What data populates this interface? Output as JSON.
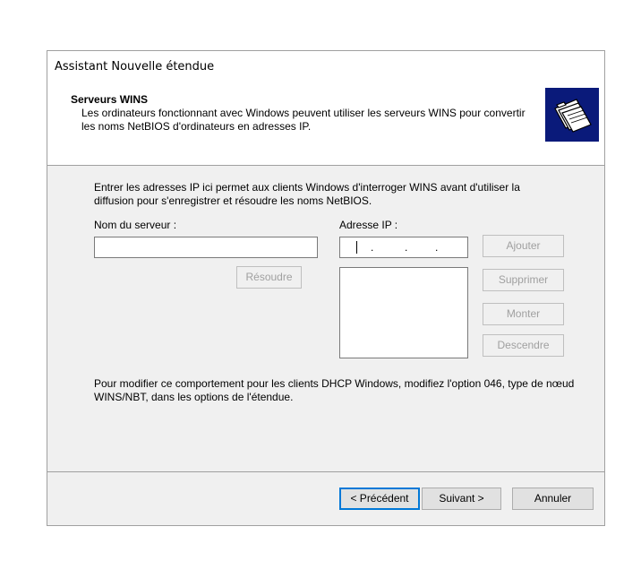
{
  "window": {
    "title": "Assistant Nouvelle étendue"
  },
  "header": {
    "title": "Serveurs WINS",
    "description": "Les ordinateurs fonctionnant avec Windows peuvent utiliser les serveurs WINS pour convertir les noms NetBIOS d'ordinateurs en adresses IP.",
    "icon": "wizard-folders-icon"
  },
  "body": {
    "instruction": "Entrer les adresses IP ici permet aux clients Windows d'interroger WINS avant d'utiliser la diffusion pour s'enregistrer et résoudre les noms NetBIOS.",
    "server_name_label": "Nom du serveur :",
    "server_name_value": "",
    "ip_label": "Adresse IP :",
    "ip_dots": [
      ".",
      ".",
      "."
    ],
    "resolve_label": "Résoudre",
    "add_label": "Ajouter",
    "remove_label": "Supprimer",
    "up_label": "Monter",
    "down_label": "Descendre",
    "note": "Pour modifier ce comportement pour les clients DHCP Windows, modifiez l'option 046, type de nœud WINS/NBT, dans les options de l'étendue."
  },
  "footer": {
    "back_label": "< Précédent",
    "next_label": "Suivant >",
    "cancel_label": "Annuler"
  }
}
